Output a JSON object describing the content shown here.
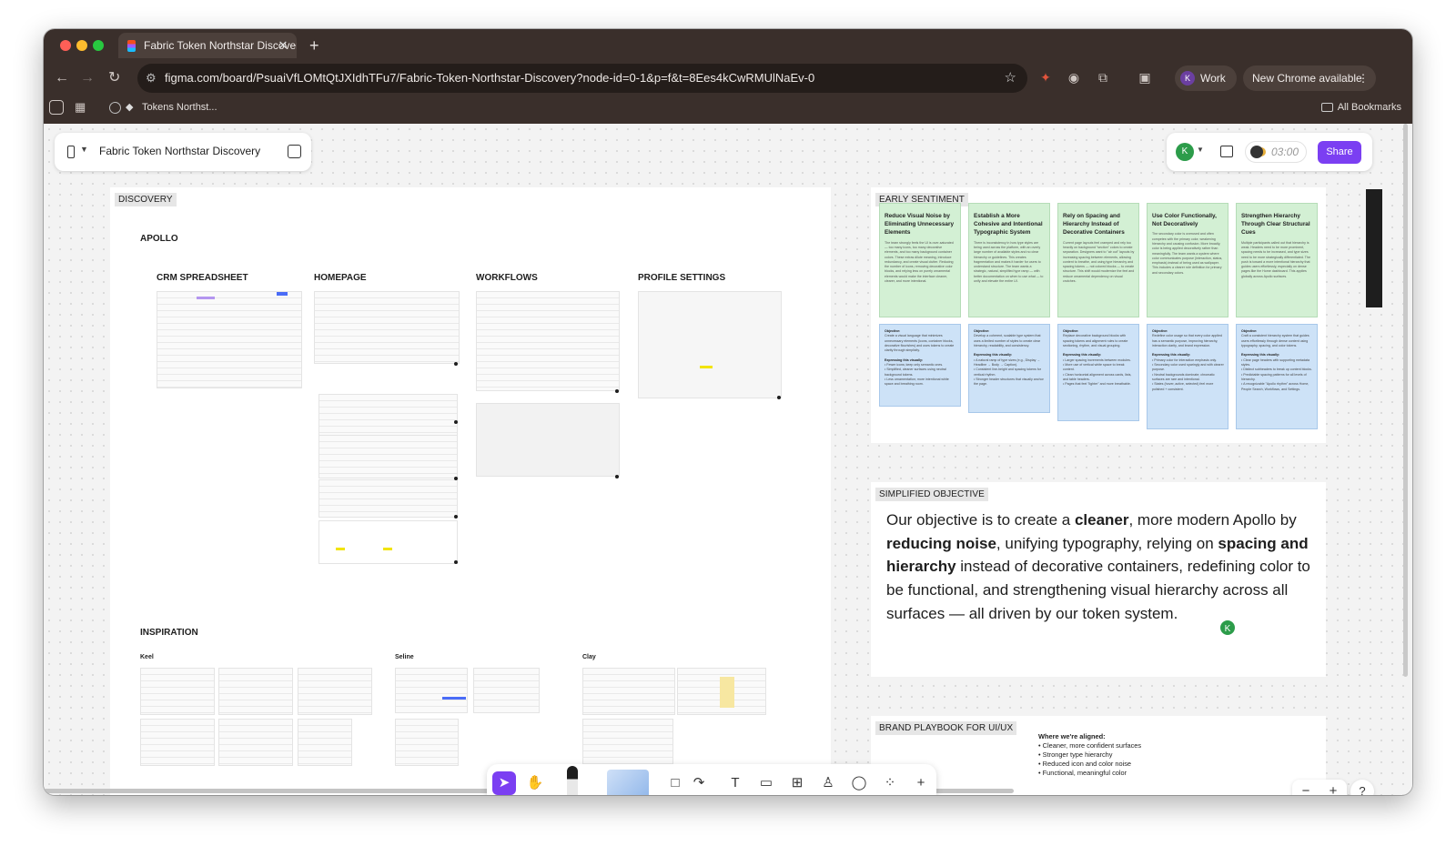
{
  "browser": {
    "tab_title": "Fabric Token Northstar Discovery – Figma",
    "new_tab": "+",
    "url": "figma.com/board/PsuaiVfLOMtQtJXIdhTFu7/Fabric-Token-Northstar-Discovery?node-id=0-1&p=f&t=8Ees4kCwRMUlNaEv-0",
    "profile_initial": "K",
    "profile_label": "Work",
    "update_label": "New Chrome available",
    "bookmark_label": "Tokens Northst...",
    "all_bookmarks": "All Bookmarks"
  },
  "file": {
    "name": "Fabric Token Northstar Discovery",
    "avatar_initial": "K",
    "timer": "03:00",
    "share_label": "Share"
  },
  "discovery": {
    "label": "DISCOVERY",
    "apollo": "APOLLO",
    "columns": [
      "CRM SPREADSHEET",
      "HOMEPAGE",
      "WORKFLOWS",
      "PROFILE SETTINGS"
    ],
    "inspiration": "INSPIRATION",
    "inspiration_sources": [
      "Keel",
      "Seline",
      "Clay"
    ]
  },
  "early_sentiment": {
    "label": "EARLY SENTIMENT",
    "cards": [
      {
        "title": "Reduce Visual Noise by Eliminating Unnecessary Elements",
        "body": "The team strongly feels the UI is over-saturated — too many icons, too many decorative elements, and too many background container colors. These extras dilute meaning, introduce redundancy, and create visual clutter. Reducing the number of icons, removing decorative color blocks, and relying less on purely ornamental elements would make the interface cleaner, clearer, and more intentional.",
        "objective": "Create a visual language that minimizes unnecessary elements (icons, container blocks, decorative flourishes) and uses tokens to create clarity through simplicity.",
        "visually": [
          "Fewer icons; keep only semantic ones.",
          "Simplified, cleaner surfaces using neutral background tokens.",
          "Less ornamentation; more intentional white space and breathing room."
        ]
      },
      {
        "title": "Establish a More Cohesive and Intentional Typographic System",
        "body": "There is inconsistency in how type styles are being used across the platform, with an overly large number of available styles and no clear hierarchy or guidelines. This creates fragmentation and makes it harder for users to understand structure. The team wants a strategic, natural, simplified type ramp — with better documentation on when to use what — to unify and elevate the entire UI.",
        "objective": "Develop a coherent, scalable type system that uses a limited number of styles to create clear hierarchy, readability, and consistency.",
        "visually": [
          "A natural ramp of type sizes (e.g., Display → Headline → Body → Caption).",
          "Consistent line-height and spacing tokens for vertical rhythm.",
          "Stronger header structures that visually anchor the page."
        ]
      },
      {
        "title": "Rely on Spacing and Hierarchy Instead of Decorative Containers",
        "body": "Current page layouts feel cramped and rely too heavily on background \"section\" colors to create separation. Designers want to \"air out\" layouts by increasing spacing between elements, allowing content to breathe, and using type hierarchy and spacing tokens — not colored blocks — to create structure. This shift would modernize the feel and reduce ornamental dependency on visual crutches.",
        "objective": "Replace decorative background blocks with spacing tokens and alignment rules to create sectioning, rhythm, and visual grouping.",
        "visually": [
          "Larger spacing increments between modules.",
          "More use of vertical white space to break content.",
          "Clean horizontal alignment across cards, lists, and table headers.",
          "Pages that feel \"lighter\" and more breathable."
        ]
      },
      {
        "title": "Use Color Functionally, Not Decoratively",
        "body": "The secondary color is overused and often competes with the primary color, weakening hierarchy and causing confusion. More broadly, color is being applied decoratively rather than meaningfully. The team wants a system where color communicates purpose (interaction, status, emphasis) instead of being used as wallpaper. This includes a clearer role definition for primary and secondary colors.",
        "objective": "Redefine color usage so that every color applied has a semantic purpose, improving hierarchy, interaction clarity, and brand expression.",
        "visually": [
          "Primary color for interaction emphasis only.",
          "Secondary color used sparingly and with clearer purpose.",
          "Neutral backgrounds dominate; chromatic surfaces are rare and intentional.",
          "States (hover, active, selected) feel more polished + consistent."
        ]
      },
      {
        "title": "Strengthen Hierarchy Through Clear Structural Cues",
        "body": "Multiple participants called out that hierarchy is weak. Headers need to be more prominent, spacing needs to be increased, and type sizes need to be more strategically differentiated. The push is toward a more intentional hierarchy that guides users effortlessly, especially on dense pages like the Home dashboard. This applies globally across Apollo surfaces.",
        "objective": "Craft a consistent hierarchy system that guides users effortlessly through dense content using typography, spacing, and color tokens.",
        "visually": [
          "Clear page headers with supporting metadata styles.",
          "Distinct subheaders to break up content blocks.",
          "Predictable spacing patterns for all levels of hierarchy.",
          "A recognizable \"Apollo rhythm\" across Home, People Search, Workflows, and Settings."
        ]
      }
    ],
    "objective_label": "Objective:",
    "visually_label": "Expressing this visually:"
  },
  "simplified_objective": {
    "label": "SIMPLIFIED OBJECTIVE",
    "t1": "Our objective is to create a ",
    "b1": "cleaner",
    "t2": ", more modern Apollo by ",
    "b2": "reducing noise",
    "t3": ", unifying typography, relying on ",
    "b3": "spacing and hierarchy",
    "t4": " instead of decorative containers, redefining color to be functional, and strengthening visual hierarchy across all surfaces — all driven by our token system.",
    "cursor_initial": "K"
  },
  "brand_playbook": {
    "label": "BRAND PLAYBOOK FOR UI/UX",
    "heading": "Where we're aligned:",
    "items": [
      "Cleaner, more confident surfaces",
      "Stronger type hierarchy",
      "Reduced icon and color noise",
      "Functional, meaningful color"
    ]
  },
  "zoom": {
    "minus": "−",
    "plus": "+"
  },
  "help": "?"
}
